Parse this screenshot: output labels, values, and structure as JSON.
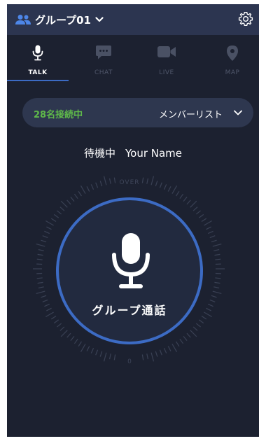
{
  "header": {
    "group_name": "グループ01",
    "group_icon": "users-icon",
    "settings_icon": "gear-icon"
  },
  "tabs": [
    {
      "label": "TALK",
      "icon": "microphone-icon",
      "active": true
    },
    {
      "label": "CHAT",
      "icon": "chat-bubble-icon",
      "active": false
    },
    {
      "label": "LIVE",
      "icon": "video-camera-icon",
      "active": false
    },
    {
      "label": "MAP",
      "icon": "map-pin-icon",
      "active": false
    }
  ],
  "members": {
    "connected": "28名接続中",
    "list_label": "メンバーリスト"
  },
  "status": {
    "state": "待機中",
    "user": "Your Name"
  },
  "talk": {
    "label": "グループ通話",
    "dial_top": "OVER",
    "dial_bottom": "0"
  },
  "colors": {
    "background": "#1c2130",
    "header": "#2c3550",
    "accent": "#3c6bc4",
    "connected": "#5fb94a"
  }
}
